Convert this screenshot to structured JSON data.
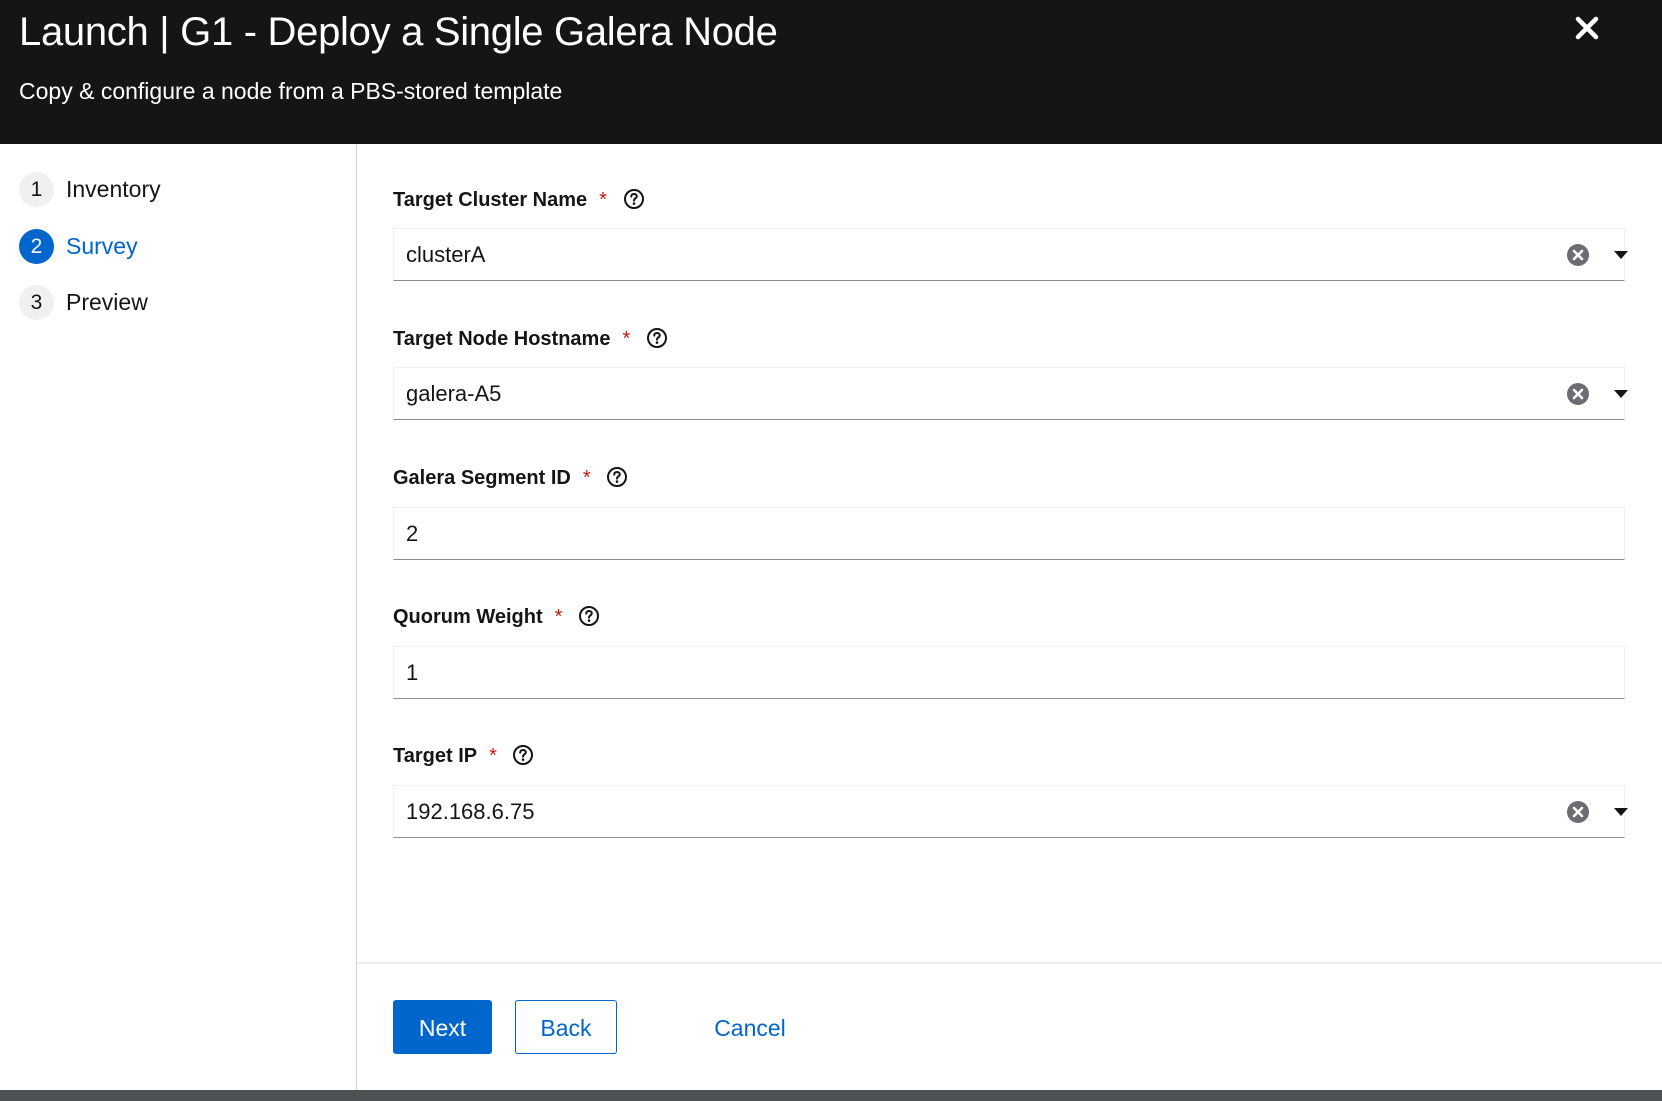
{
  "header": {
    "title": "Launch | G1 - Deploy a Single Galera Node",
    "subtitle": "Copy & configure a node from a PBS-stored template",
    "close_icon": "close-icon"
  },
  "wizard_nav": {
    "steps": [
      {
        "number": "1",
        "label": "Inventory",
        "current": false
      },
      {
        "number": "2",
        "label": "Survey",
        "current": true
      },
      {
        "number": "3",
        "label": "Preview",
        "current": false
      }
    ]
  },
  "form": {
    "required_marker": "*",
    "fields": [
      {
        "label": "Target Cluster Name",
        "value": "clusterA",
        "type": "select"
      },
      {
        "label": "Target Node Hostname",
        "value": "galera-A5",
        "type": "select"
      },
      {
        "label": "Galera Segment ID",
        "value": "2",
        "type": "text"
      },
      {
        "label": "Quorum Weight",
        "value": "1",
        "type": "text"
      },
      {
        "label": "Target IP",
        "value": "192.168.6.75",
        "type": "select"
      }
    ]
  },
  "footer": {
    "next_label": "Next",
    "back_label": "Back",
    "cancel_label": "Cancel"
  },
  "colors": {
    "header_bg": "#151515",
    "accent": "#0066cc",
    "required": "#c9190b"
  }
}
